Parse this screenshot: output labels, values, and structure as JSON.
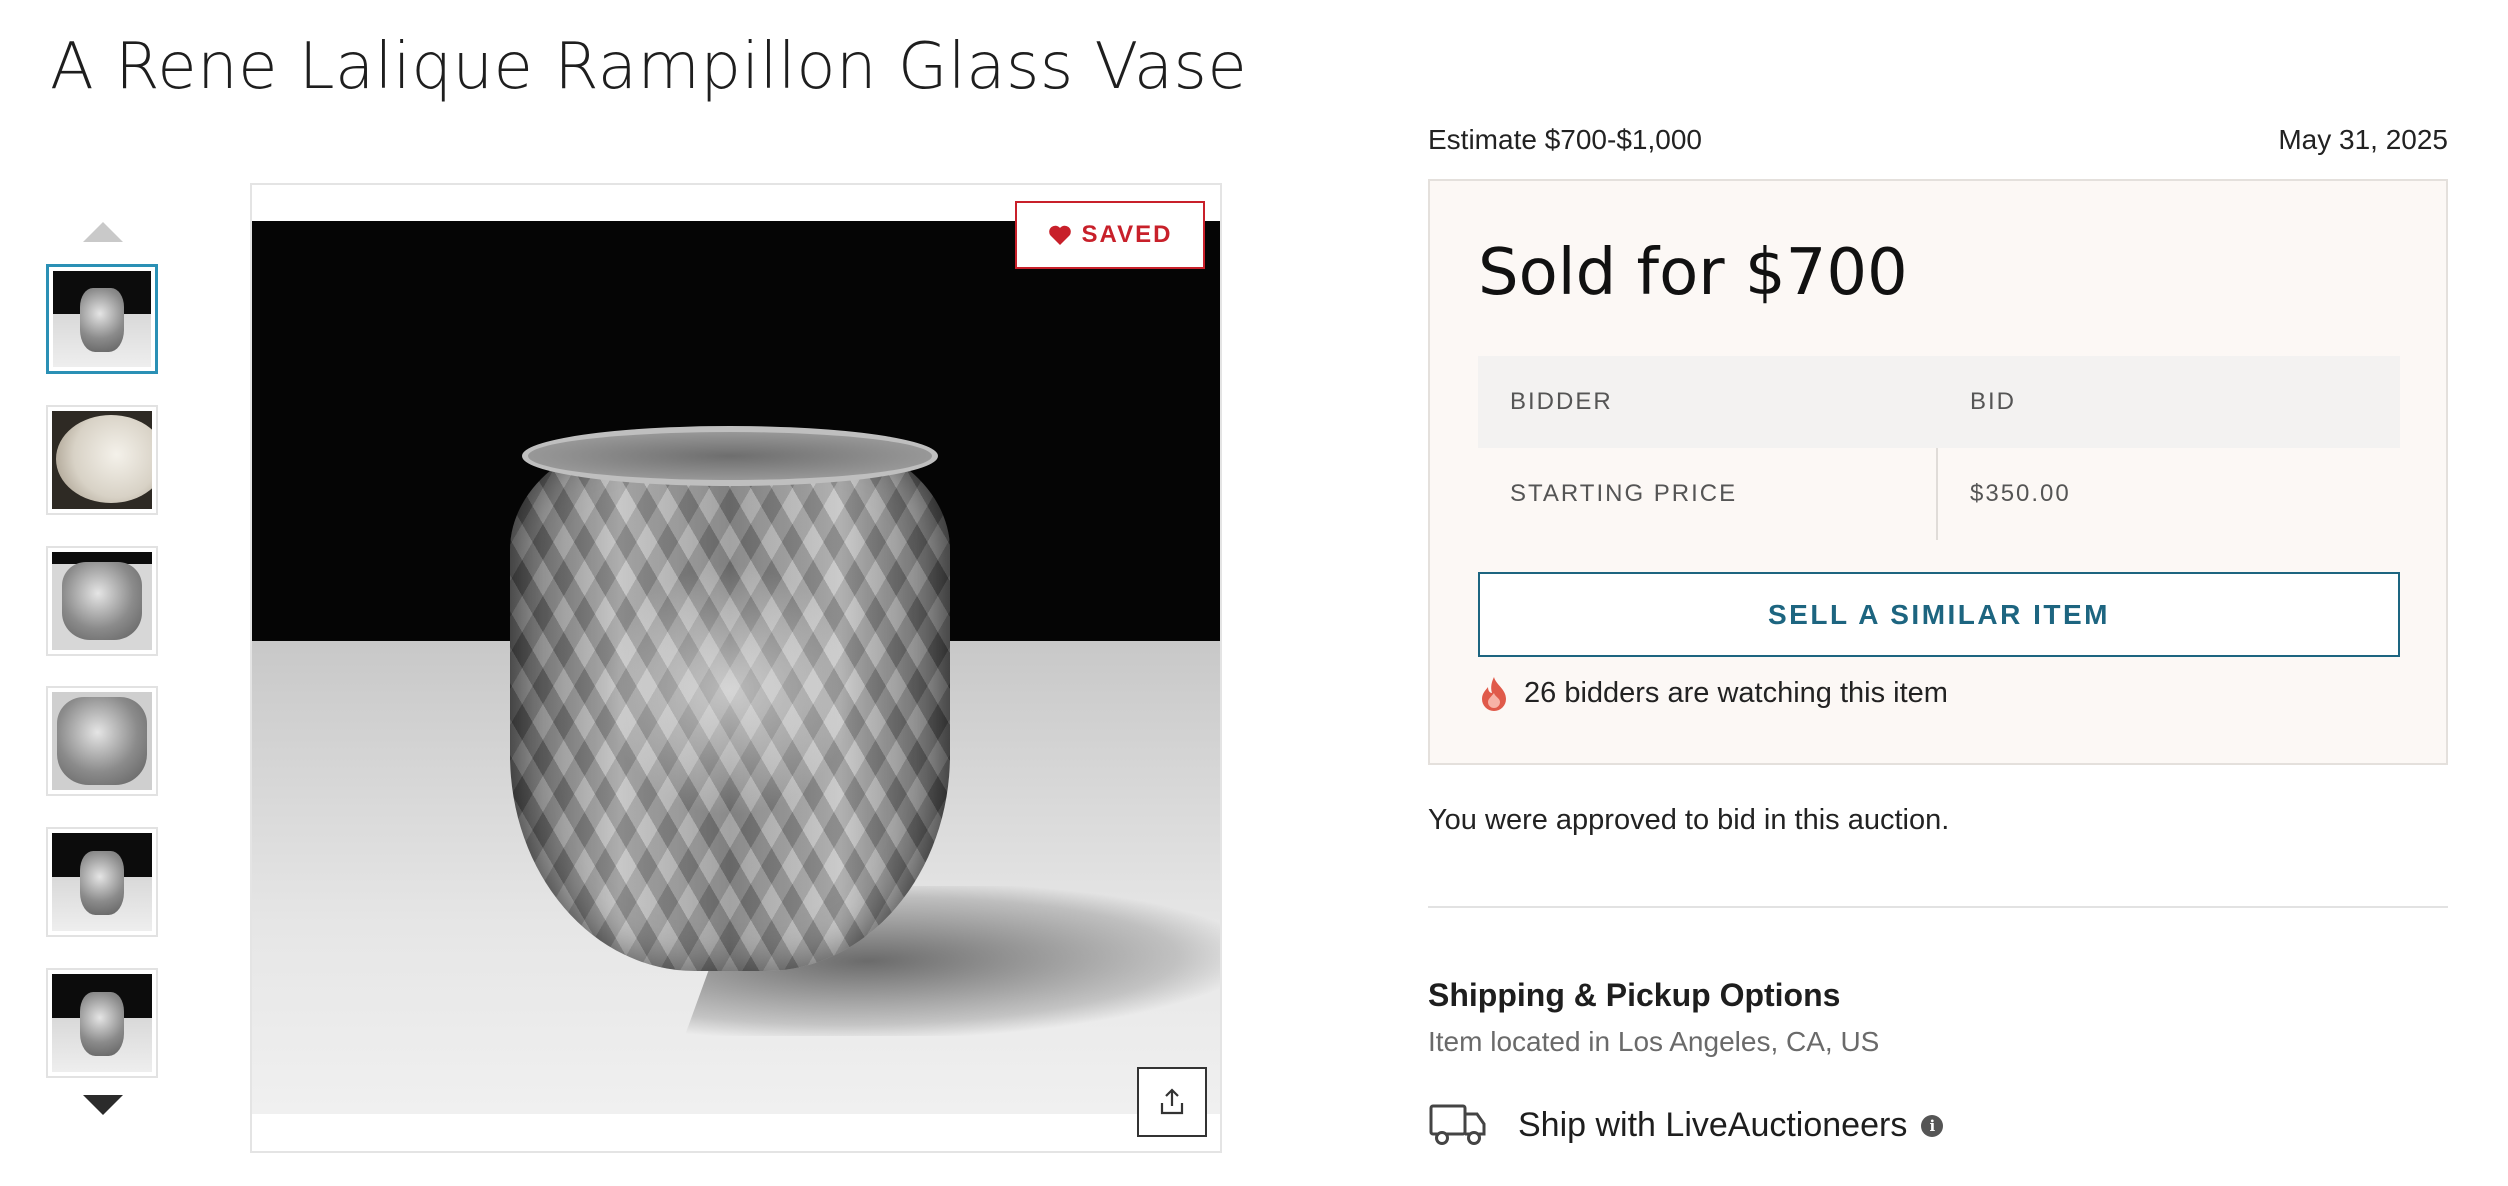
{
  "lot": {
    "title": "A Rene Lalique Rampillon Glass Vase"
  },
  "gallery": {
    "saved_label": "SAVED",
    "thumbnails": [
      {
        "kind": "vase-dark",
        "selected": true
      },
      {
        "kind": "plate",
        "selected": false
      },
      {
        "kind": "vase-detail",
        "selected": false
      },
      {
        "kind": "vase-closeup",
        "selected": false
      },
      {
        "kind": "vase-dark",
        "selected": false
      },
      {
        "kind": "vase-dark",
        "selected": false
      }
    ],
    "icons": {
      "saved": "heart-icon",
      "share": "share-icon",
      "prev": "triangle-up-icon",
      "next": "triangle-down-icon"
    }
  },
  "auction": {
    "estimate": "Estimate $700-$1,000",
    "date": "May 31, 2025",
    "sold_for": "Sold for $700",
    "bid_table": {
      "headers": [
        "BIDDER",
        "BID"
      ],
      "rows": [
        {
          "bidder": "STARTING PRICE",
          "bid": "$350.00"
        }
      ]
    },
    "sell_similar_label": "SELL A SIMILAR ITEM",
    "watchers_text": "26 bidders are watching this item",
    "approved_text": "You were approved to bid in this auction."
  },
  "shipping": {
    "heading": "Shipping & Pickup Options",
    "location": "Item located in Los Angeles, CA, US",
    "option_label": "Ship with LiveAuctioneers",
    "info_glyph": "i"
  },
  "colors": {
    "accent_blue": "#1d6580",
    "saved_red": "#c8202a",
    "thumb_selected": "#2a90b5",
    "panel_bg": "#fcf8f5"
  }
}
